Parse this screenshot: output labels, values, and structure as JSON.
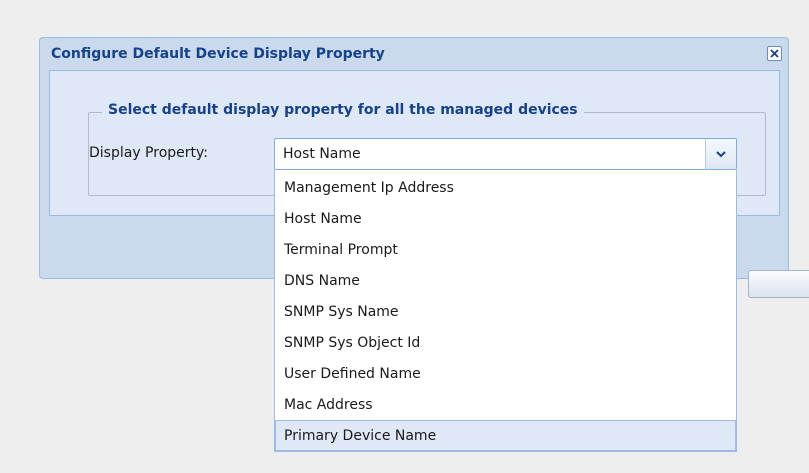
{
  "dialog": {
    "title": "Configure Default Device Display Property",
    "close_icon": "close-icon",
    "fieldset_legend": "Select default display property for all the managed devices",
    "field_label": "Display Property:",
    "combo_value": "Host Name",
    "trigger_icon": "chevron-down-icon",
    "footer_button_label": ""
  },
  "dropdown": {
    "options": [
      "Management Ip Address",
      "Host Name",
      "Terminal Prompt",
      "DNS Name",
      "SNMP Sys Name",
      "SNMP Sys Object Id",
      "User Defined Name",
      "Mac Address",
      "Primary Device Name"
    ],
    "highlighted": "Primary Device Name"
  },
  "colors": {
    "title_text": "#15428b",
    "dialog_frame": "#cad9ec",
    "panel_background": "#dfe8f6",
    "highlight": "#dfe8f6",
    "page_background": "#eeeeee"
  }
}
